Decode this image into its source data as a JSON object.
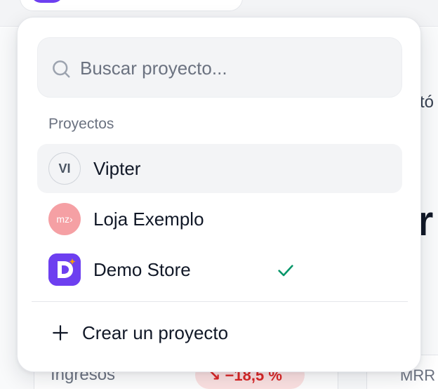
{
  "background": {
    "peek_text": "tó",
    "peek_big": "r",
    "card_label": "Ingresos",
    "badge": "↘ −18,5 %",
    "card2_label": "MRR"
  },
  "dropdown": {
    "search": {
      "placeholder": "Buscar proyecto...",
      "value": ""
    },
    "section_label": "Proyectos",
    "items": [
      {
        "label": "Vipter",
        "avatar_text": "VI",
        "active": true,
        "selected": false
      },
      {
        "label": "Loja Exemplo",
        "avatar_text": "mz›",
        "active": false,
        "selected": false
      },
      {
        "label": "Demo Store",
        "avatar_text": "D",
        "active": false,
        "selected": true
      }
    ],
    "create_label": "Crear un proyecto"
  },
  "colors": {
    "accent": "#6d3ff0",
    "check": "#059669",
    "badge_bg": "#fde2e2",
    "badge_text": "#dc2626",
    "avatar_loja": "#f5a0a4",
    "sparkle": "#f59e0b"
  },
  "icons": {
    "search": "search-icon",
    "check": "check-icon",
    "plus": "plus-icon"
  }
}
